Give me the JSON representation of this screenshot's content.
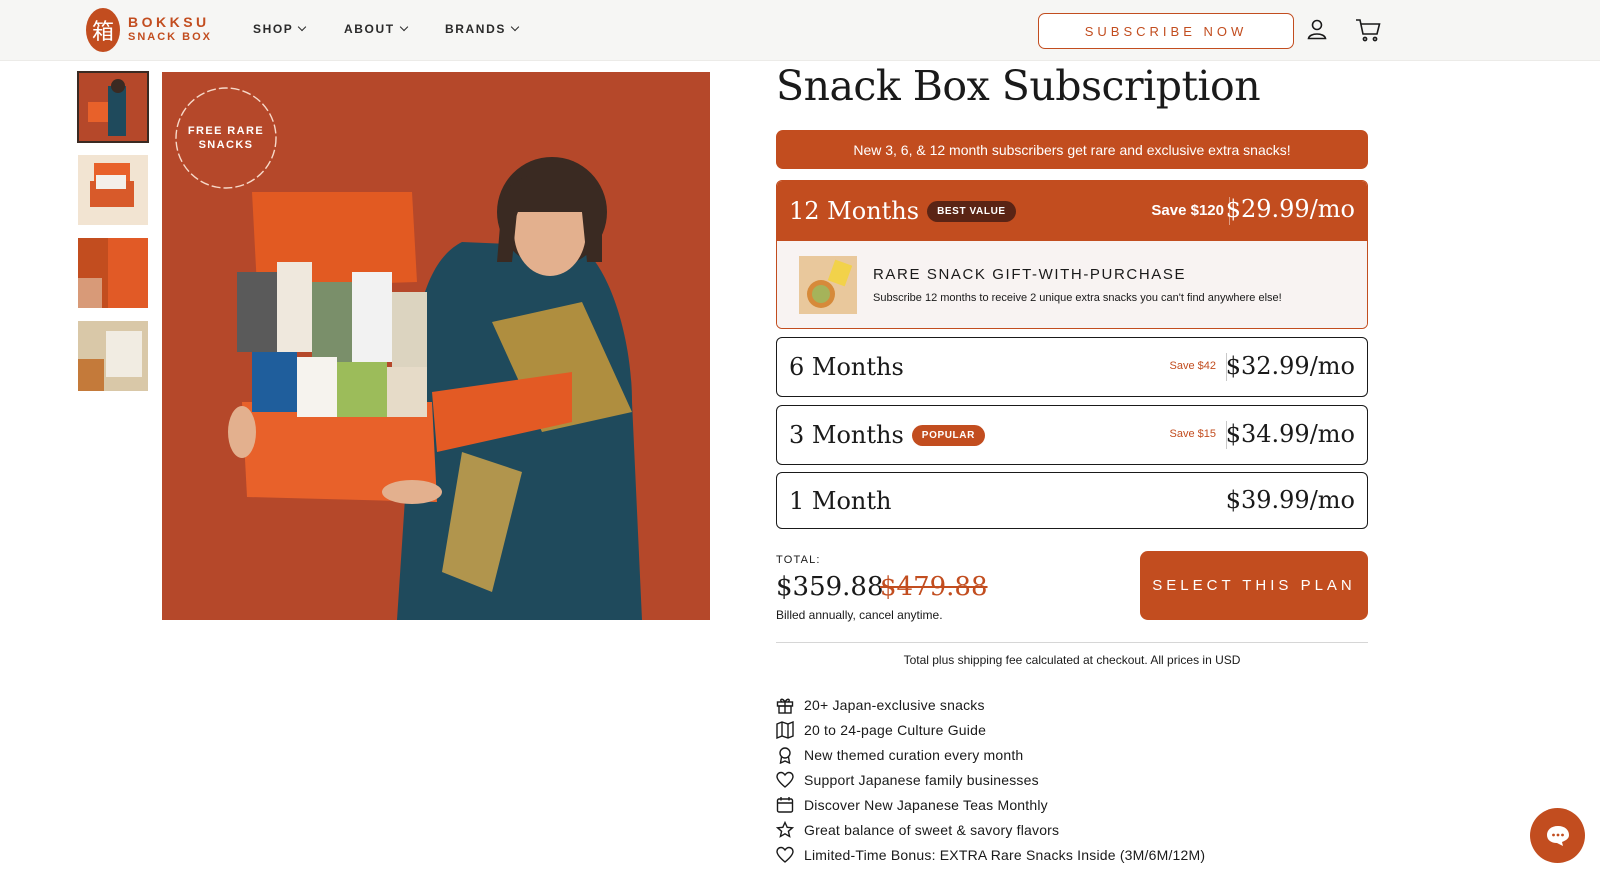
{
  "header": {
    "logo_line1": "BOKKSU",
    "logo_line2": "SNACK BOX",
    "logo_glyph": "箱",
    "nav": [
      {
        "label": "SHOP"
      },
      {
        "label": "ABOUT"
      },
      {
        "label": "BRANDS"
      }
    ],
    "subscribe_label": "SUBSCRIBE NOW",
    "icons": [
      "account-icon",
      "cart-icon"
    ]
  },
  "gallery": {
    "badge_text": "FREE RARE SNACKS",
    "thumbnails": 4,
    "active_index": 0
  },
  "product": {
    "title": "Snack Box Subscription",
    "promo": "New 3, 6, & 12 month subscribers get rare and exclusive extra snacks!"
  },
  "plans": [
    {
      "name": "12 Months",
      "badge": "BEST VALUE",
      "save": "Save $120",
      "price": "$29.99/mo",
      "selected": true
    },
    {
      "name": "6 Months",
      "badge": "",
      "save": "Save $42",
      "price": "$32.99/mo",
      "selected": false
    },
    {
      "name": "3 Months",
      "badge": "POPULAR",
      "save": "Save $15",
      "price": "$34.99/mo",
      "selected": false
    },
    {
      "name": "1 Month",
      "badge": "",
      "save": "",
      "price": "$39.99/mo",
      "selected": false
    }
  ],
  "gift": {
    "title": "RARE SNACK GIFT-WITH-PURCHASE",
    "subtitle": "Subscribe 12 months to receive 2 unique extra snacks you can't find anywhere else!"
  },
  "total": {
    "label": "TOTAL:",
    "price": "$359.88",
    "old_price": "$479.88",
    "billed": "Billed annually, cancel anytime.",
    "select_label": "SELECT THIS PLAN",
    "shipping_note": "Total plus shipping fee calculated at checkout. All prices in USD"
  },
  "features": [
    {
      "icon": "gift-icon",
      "text": "20+ Japan-exclusive snacks"
    },
    {
      "icon": "map-icon",
      "text": "20 to 24-page Culture Guide"
    },
    {
      "icon": "award-icon",
      "text": "New themed curation every month"
    },
    {
      "icon": "heart-icon",
      "text": "Support Japanese family businesses"
    },
    {
      "icon": "calendar-icon",
      "text": "Discover New Japanese Teas Monthly"
    },
    {
      "icon": "star-icon",
      "text": "Great balance of sweet & savory flavors"
    },
    {
      "icon": "heart-icon",
      "text": "Limited-Time Bonus: EXTRA Rare Snacks Inside (3M/6M/12M)"
    }
  ],
  "colors": {
    "accent": "#c24d1f",
    "header_bg": "#f6f6f4",
    "gift_bg": "#f8f3f2",
    "badge_dark": "#5a2415",
    "badge_popular": "#c24d1f"
  }
}
